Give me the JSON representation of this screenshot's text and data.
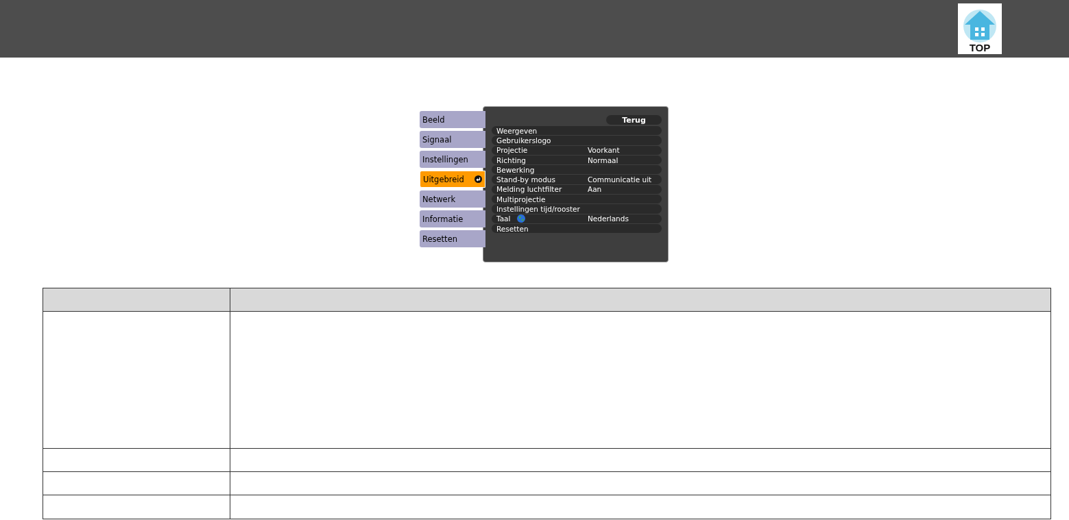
{
  "header": {
    "logo_text": "TOP"
  },
  "menu": {
    "tabs": [
      {
        "label": "Beeld",
        "selected": false
      },
      {
        "label": "Signaal",
        "selected": false
      },
      {
        "label": "Instellingen",
        "selected": false
      },
      {
        "label": "Uitgebreid",
        "selected": true
      },
      {
        "label": "Netwerk",
        "selected": false
      },
      {
        "label": "Informatie",
        "selected": false
      },
      {
        "label": "Resetten",
        "selected": false
      }
    ],
    "back_button": "Terug",
    "items": [
      {
        "label": "Weergeven",
        "kind": "plain"
      },
      {
        "label": "Gebruikerslogo",
        "kind": "plain"
      },
      {
        "label": "Projectie",
        "value": "Voorkant",
        "kind": "plain"
      },
      {
        "label": "Richting",
        "value": "Normaal",
        "kind": "plain"
      },
      {
        "label": "Bewerking",
        "kind": "plain"
      },
      {
        "label": "Stand-by modus",
        "value": "Communicatie uit",
        "kind": "plain"
      },
      {
        "label": "Melding luchtfilter",
        "value": "Aan",
        "kind": "plain"
      },
      {
        "label": "Multiprojectie",
        "kind": "plain"
      },
      {
        "label": "Instellingen tijd/rooster",
        "kind": "plain"
      },
      {
        "label": "Taal",
        "value": "Nederlands",
        "kind": "globe"
      },
      {
        "label": "Resetten",
        "kind": "plain"
      }
    ]
  }
}
